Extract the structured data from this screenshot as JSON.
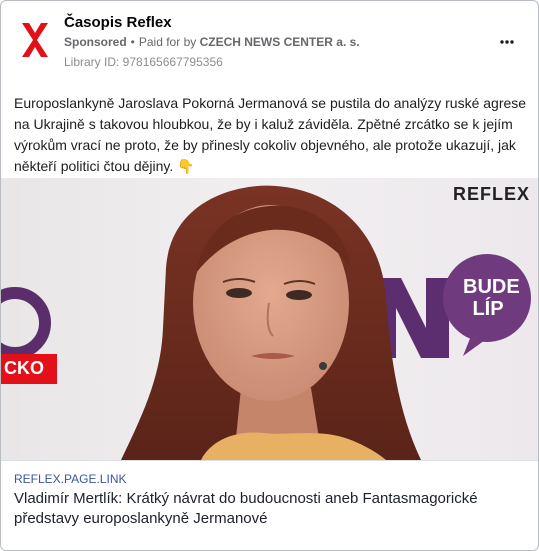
{
  "header": {
    "page_name": "Časopis Reflex",
    "sponsored_label": "Sponsored",
    "separator": "•",
    "paid_for_by_prefix": "Paid for by",
    "paid_for_by_name": "CZECH NEWS CENTER a. s.",
    "library_id": "Library ID: 978165667795356",
    "more_icon": "ellipsis-icon"
  },
  "post": {
    "text": "Europoslankyně Jaroslava Pokorná Jermanová se pustila do analýzy ruské agrese na Ukrajině s takovou hloubkou, že by i kaluž záviděla. Zpětné zrcátko se k jejím výrokům vrací ne proto, že by přinesly cokoliv objevného, ale protože ukazují, jak někteří politici čtou dějiny. 👇"
  },
  "image": {
    "watermark": "REFLEX",
    "badge_line1": "BUDE",
    "badge_line2": "LÍP",
    "left_sign": "CKO"
  },
  "link": {
    "domain": "reflex.page.link",
    "title": "Vladimír Mertlík: Krátký návrat do budoucnosti aneb Fantasmagorické představy europoslankyně Jermanové"
  },
  "colors": {
    "brand_red": "#e3101a",
    "badge_purple": "#6f3a7e",
    "link_blue": "#385898"
  }
}
